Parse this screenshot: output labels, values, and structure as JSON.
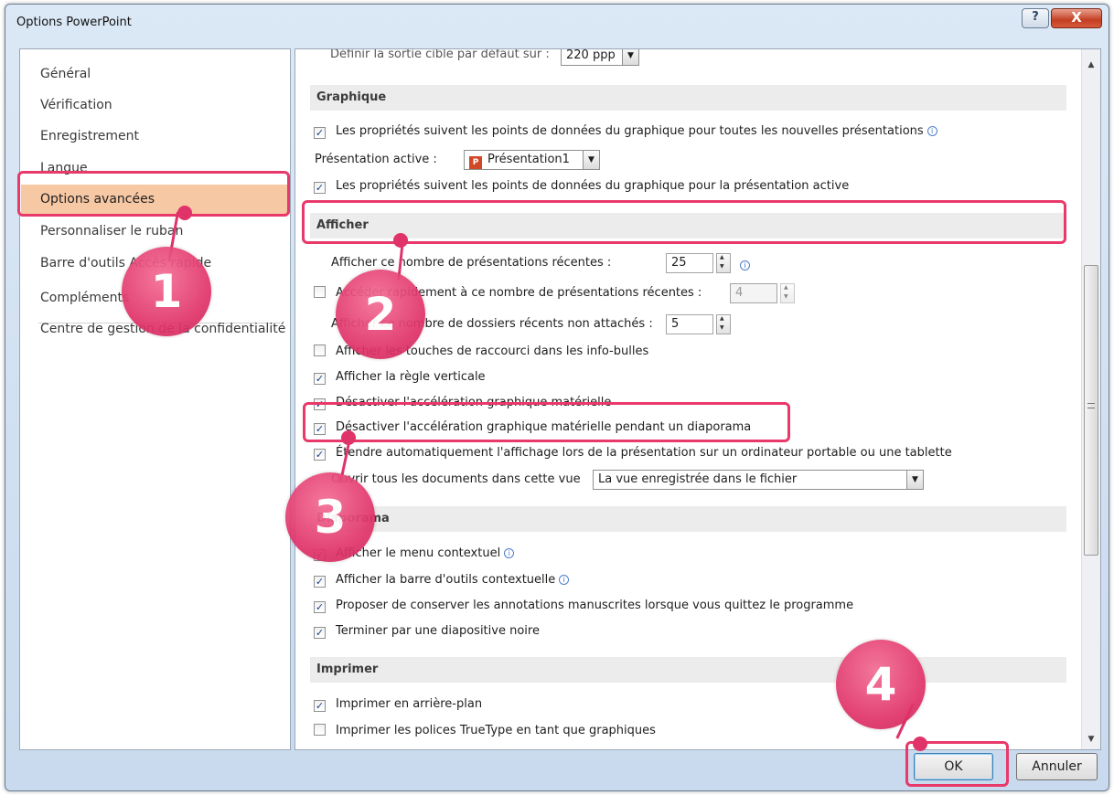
{
  "window": {
    "title": "Options PowerPoint",
    "help": "?",
    "close": "X"
  },
  "sidebar": {
    "items": [
      {
        "label": "Général"
      },
      {
        "label": "Vérification"
      },
      {
        "label": "Enregistrement"
      },
      {
        "label": "Langue"
      },
      {
        "label": "Options avancées"
      },
      {
        "label": "Personnaliser le ruban"
      },
      {
        "label": "Barre d'outils Accès rapide"
      },
      {
        "label": "Compléments"
      },
      {
        "label": "Centre de gestion de la confidentialité"
      }
    ]
  },
  "top_row": {
    "label": "Définir la sortie cible par défaut sur :",
    "value": "220 ppp"
  },
  "graphique": {
    "header": "Graphique",
    "option1": "Les propriétés suivent les points de données du graphique pour toutes les nouvelles présentations",
    "active_label": "Présentation active :",
    "active_value": "Présentation1",
    "option2": "Les propriétés suivent les points de données du graphique pour la présentation active"
  },
  "afficher": {
    "header": "Afficher",
    "recent_label": "Afficher ce nombre de présentations récentes :",
    "recent_value": "25",
    "quick_label": "Accéder rapidement à ce nombre de présentations récentes :",
    "quick_value": "4",
    "folders_label": "Afficher ce nombre de dossiers récents non attachés :",
    "folders_value": "5",
    "shortcut_keys": "Afficher les touches de raccourci dans les info-bulles",
    "vertical_ruler": "Afficher la règle verticale",
    "disable_accel": "Désactiver l'accélération graphique matérielle",
    "disable_accel_slideshow": "Désactiver l'accélération graphique matérielle pendant un diaporama",
    "extend_display": "Étendre automatiquement l'affichage lors de la présentation sur un ordinateur portable ou une tablette",
    "open_docs_label": "Ouvrir tous les documents dans cette vue",
    "open_docs_value": "La vue enregistrée dans le fichier"
  },
  "diaporama": {
    "header": "Diaporama",
    "context_menu": "Afficher le menu contextuel",
    "context_toolbar": "Afficher la barre d'outils contextuelle",
    "keep_ink": "Proposer de conserver les annotations manuscrites lorsque vous quittez le programme",
    "end_black": "Terminer par une diapositive noire"
  },
  "imprimer": {
    "header": "Imprimer",
    "background": "Imprimer en arrière-plan",
    "truetype": "Imprimer les polices TrueType en tant que graphiques"
  },
  "buttons": {
    "ok": "OK",
    "cancel": "Annuler"
  },
  "annotations": {
    "badge1": "1",
    "badge2": "2",
    "badge3": "3",
    "badge4": "4",
    "accent": "#e0336a"
  },
  "icons": {
    "checkbox": "check-icon",
    "info": "info-icon",
    "dropdown": "chevron-down-icon",
    "spinner": "spinner-arrows-icon"
  }
}
